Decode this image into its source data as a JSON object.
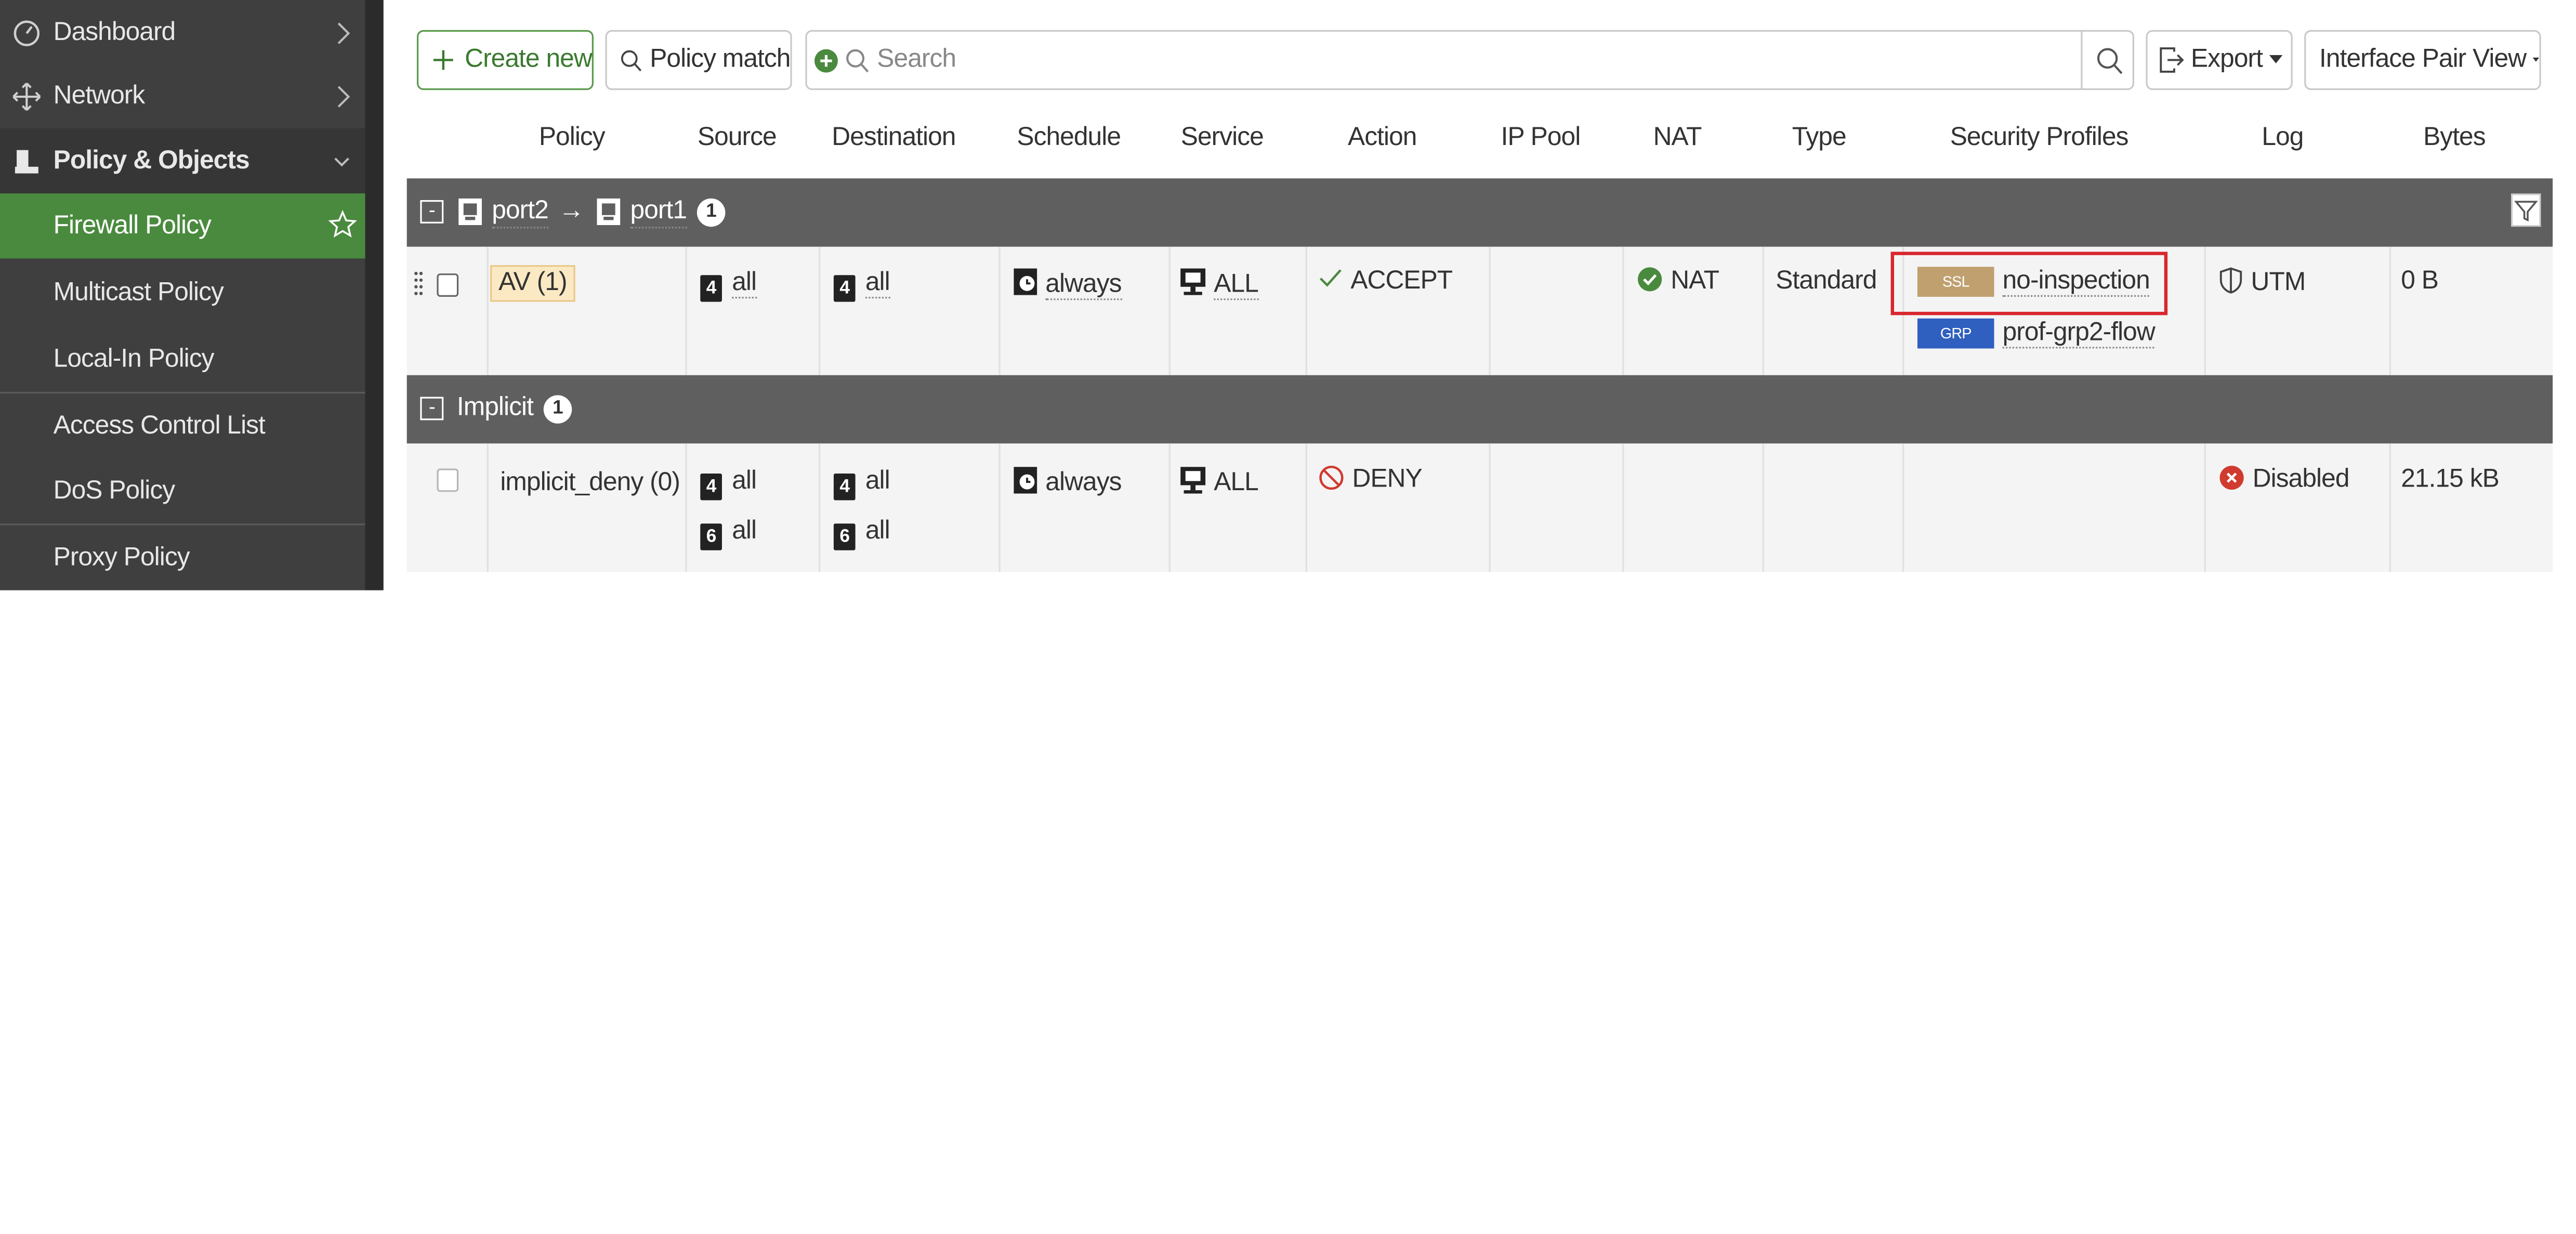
{
  "sidebar": {
    "items": [
      {
        "label": "Dashboard",
        "icon": "dashboard-icon"
      },
      {
        "label": "Network",
        "icon": "network-icon"
      },
      {
        "label": "Policy & Objects",
        "icon": "policy-objects-icon"
      },
      {
        "label": "Firewall Policy"
      },
      {
        "label": "Multicast Policy"
      },
      {
        "label": "Local-In Policy"
      },
      {
        "label": "Access Control List"
      },
      {
        "label": "DoS Policy"
      },
      {
        "label": "Proxy Policy"
      }
    ],
    "active_color": "#4a8a3e",
    "background": "#3f3f3f"
  },
  "toolbar": {
    "create_label": "Create new",
    "policy_match_label": "Policy match",
    "search_placeholder": "Search",
    "export_label": "Export",
    "view_label": "Interface Pair View"
  },
  "table": {
    "columns": [
      "Policy",
      "Source",
      "Destination",
      "Schedule",
      "Service",
      "Action",
      "IP Pool",
      "NAT",
      "Type",
      "Security Profiles",
      "Log",
      "Bytes"
    ],
    "groups": [
      {
        "from": "port2",
        "arrow": "→",
        "to": "port1",
        "count": "1",
        "rows": [
          {
            "policy": "AV (1)",
            "source": "all",
            "source_tag": "4",
            "destination": "all",
            "destination_tag": "4",
            "schedule": "always",
            "service": "ALL",
            "action": "ACCEPT",
            "ip_pool": "",
            "nat": "NAT",
            "type": "Standard",
            "profiles": [
              {
                "tag": "SSL",
                "name": "no-inspection",
                "tag_color": "#bfa06e"
              },
              {
                "tag": "GRP",
                "name": "prof-grp2-flow",
                "tag_color": "#2f5fbf"
              }
            ],
            "log": "UTM",
            "bytes": "0 B"
          }
        ]
      },
      {
        "name": "Implicit",
        "count": "1",
        "rows": [
          {
            "policy": "implicit_deny (0)",
            "source": [
              "all",
              "all"
            ],
            "source_tags": [
              "4",
              "6"
            ],
            "destination": [
              "all",
              "all"
            ],
            "destination_tags": [
              "4",
              "6"
            ],
            "schedule": "always",
            "service": "ALL",
            "action": "DENY",
            "log": "Disabled",
            "bytes": "21.15 kB"
          }
        ]
      }
    ]
  },
  "colors": {
    "accept": "#4a8a3e",
    "deny": "#d03a2f",
    "highlight_box": "#d9262d",
    "group_bar": "#5f5f5f"
  }
}
